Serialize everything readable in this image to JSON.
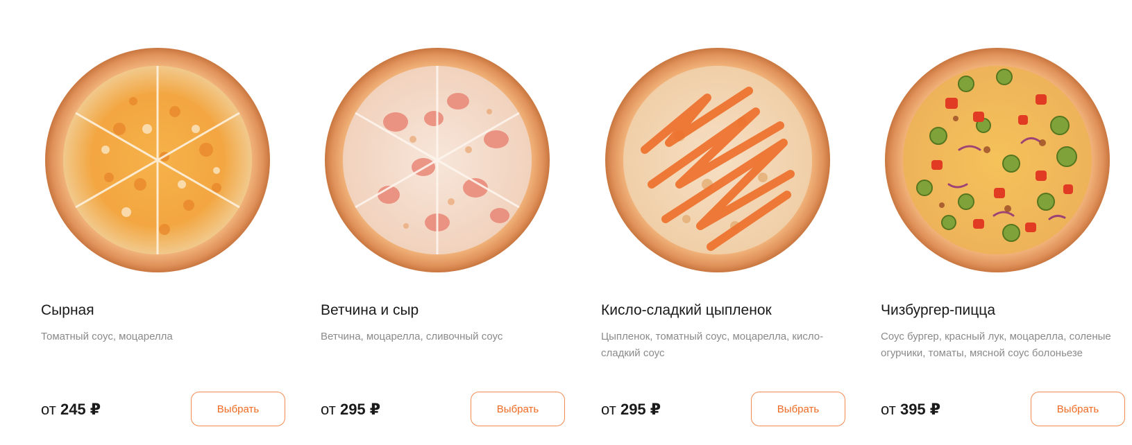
{
  "products": [
    {
      "name": "Сырная",
      "description": "Томатный соус, моцарелла",
      "price_prefix": "от",
      "price_value": "245 ₽",
      "button_label": "Выбрать",
      "image_icon": "cheese-pizza-icon"
    },
    {
      "name": "Ветчина и сыр",
      "description": "Ветчина, моцарелла, сливочный соус",
      "price_prefix": "от",
      "price_value": "295 ₽",
      "button_label": "Выбрать",
      "image_icon": "ham-cheese-pizza-icon"
    },
    {
      "name": "Кисло-сладкий цыпленок",
      "description": "Цыпленок, томатный соус, моцарелла, кисло-сладкий соус",
      "price_prefix": "от",
      "price_value": "295 ₽",
      "button_label": "Выбрать",
      "image_icon": "sweet-sour-chicken-pizza-icon"
    },
    {
      "name": "Чизбургер-пицца",
      "description": "Соус бургер, красный лук, моцарелла, соленые огурчики, томаты, мясной соус болоньезе",
      "price_prefix": "от",
      "price_value": "395 ₽",
      "button_label": "Выбрать",
      "image_icon": "cheeseburger-pizza-icon"
    }
  ],
  "colors": {
    "accent": "#ee6a22",
    "button_border": "#f28a4f",
    "title_text": "#1a1a1a",
    "description_text": "#8a8a8a",
    "crust": "#e0925a"
  }
}
